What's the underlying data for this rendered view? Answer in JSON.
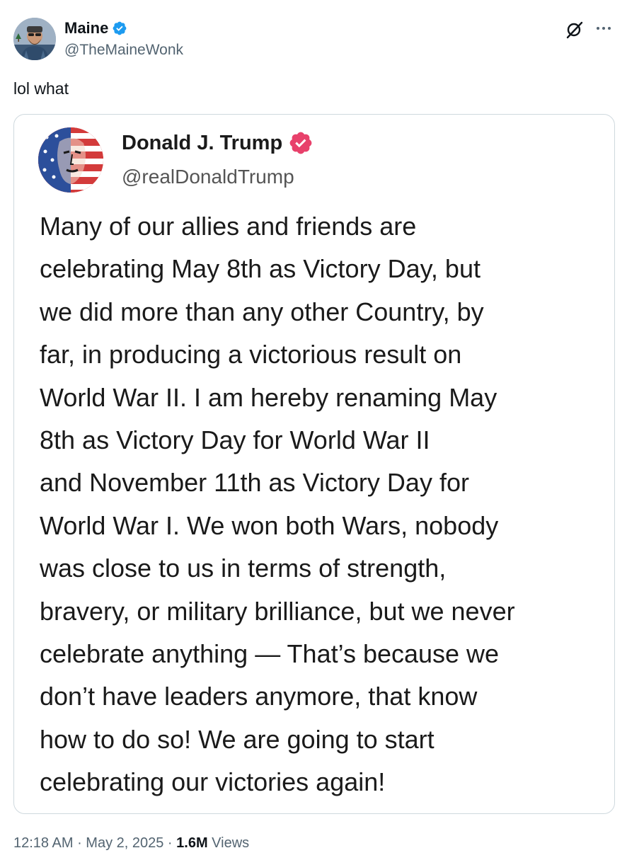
{
  "author": {
    "name": "Maine",
    "handle": "@TheMaineWonk",
    "verified_color": "#1d9bf0"
  },
  "tweet": {
    "text": "lol what"
  },
  "quoted_post": {
    "name": "Donald J. Trump",
    "handle": "@realDonaldTrump",
    "verified_color": "#e8416b",
    "lines": [
      "Many of our allies and friends are",
      "celebrating May 8th as Victory Day, but",
      "we did more than any other Country, by",
      "far, in producing a victorious result on",
      "World War II. I am hereby renaming May",
      "8th as Victory Day for World War II",
      "and November 11th as Victory Day for",
      "World War I. We won both Wars, nobody",
      "was close to us in terms of strength,",
      "bravery, or military brilliance, but we never",
      "celebrate anything — That’s because we",
      "don’t have leaders  anymore, that know",
      "how to do so! We are going to start",
      "celebrating our victories again!"
    ]
  },
  "meta": {
    "time": "12:18 AM",
    "separator": " · ",
    "date": "May 2, 2025",
    "views_count": "1.6M",
    "views_label": " Views"
  },
  "icons": {
    "grok": "grok-icon",
    "more": "more-icon",
    "verified": "verified-badge-icon"
  }
}
